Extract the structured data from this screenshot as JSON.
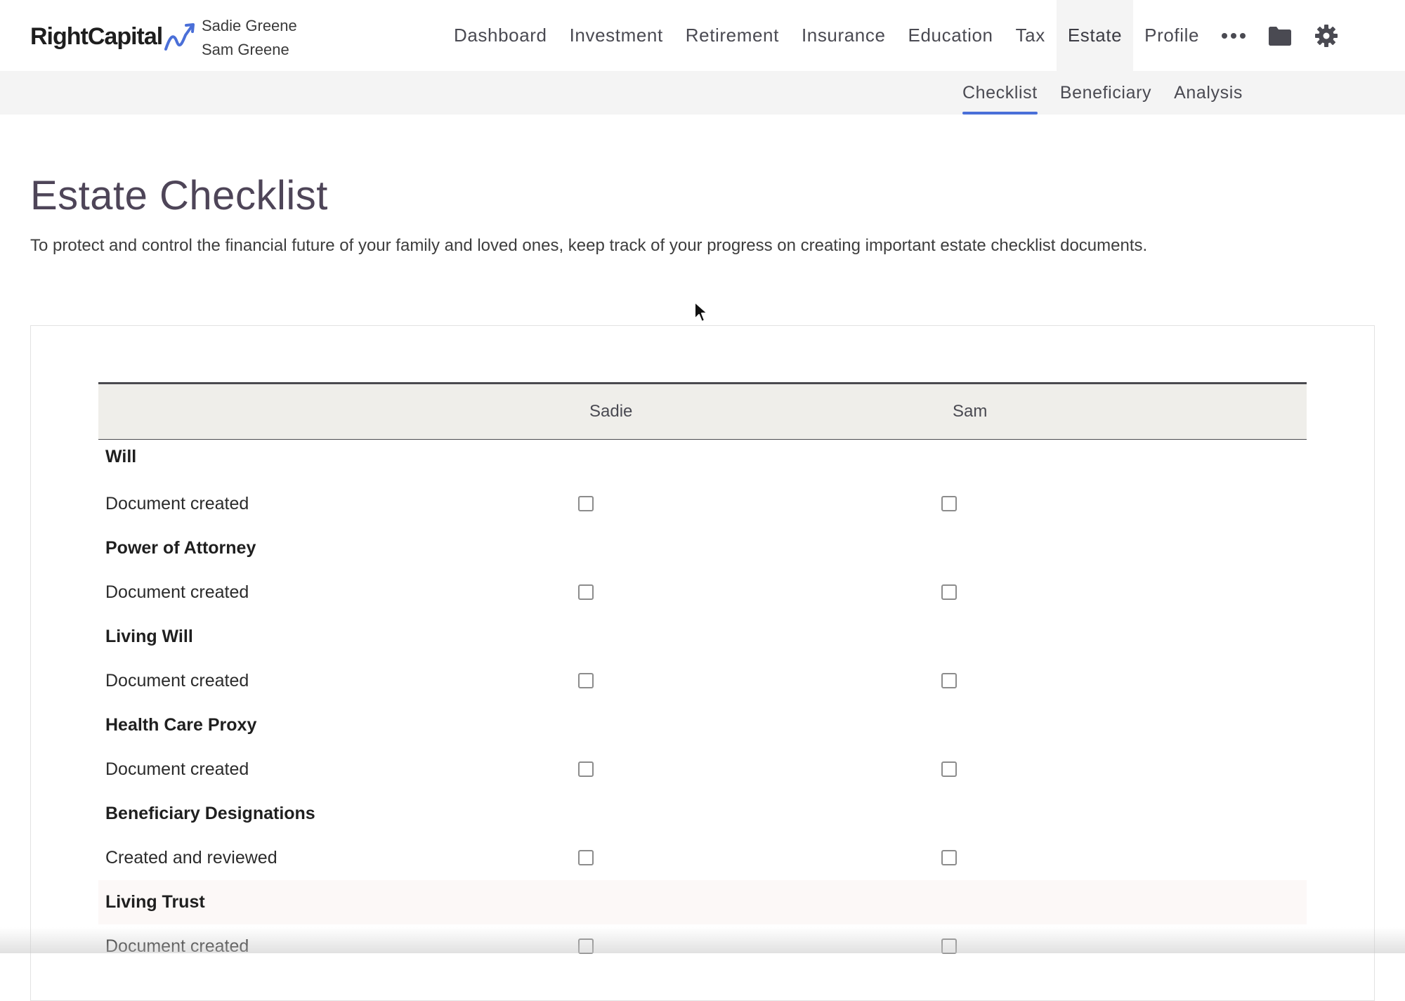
{
  "brand": {
    "name": "RightCapital",
    "accent_color": "#4a6fd8"
  },
  "clients": {
    "primary": "Sadie Greene",
    "spouse": "Sam Greene"
  },
  "main_nav": {
    "items": [
      {
        "label": "Dashboard"
      },
      {
        "label": "Investment"
      },
      {
        "label": "Retirement"
      },
      {
        "label": "Insurance"
      },
      {
        "label": "Education"
      },
      {
        "label": "Tax"
      },
      {
        "label": "Estate",
        "active": true
      },
      {
        "label": "Profile"
      }
    ],
    "icons": [
      "more-icon",
      "folder-icon",
      "gear-icon"
    ]
  },
  "sub_nav": {
    "items": [
      {
        "label": "Checklist",
        "active": true
      },
      {
        "label": "Beneficiary"
      },
      {
        "label": "Analysis"
      }
    ]
  },
  "page": {
    "title": "Estate Checklist",
    "description": "To protect and control the financial future of your family and loved ones, keep track of your progress on creating important estate checklist documents."
  },
  "table": {
    "columns": [
      "Sadie",
      "Sam"
    ],
    "sections": [
      {
        "title": "Will",
        "item": "Document created",
        "sadie_checked": false,
        "sam_checked": false
      },
      {
        "title": "Power of Attorney",
        "item": "Document created",
        "sadie_checked": false,
        "sam_checked": false
      },
      {
        "title": "Living Will",
        "item": "Document created",
        "sadie_checked": false,
        "sam_checked": false
      },
      {
        "title": "Health Care Proxy",
        "item": "Document created",
        "sadie_checked": false,
        "sam_checked": false
      },
      {
        "title": "Beneficiary Designations",
        "item": "Created and reviewed",
        "sadie_checked": false,
        "sam_checked": false
      },
      {
        "title": "Living Trust",
        "item": "Document created",
        "sadie_checked": false,
        "sam_checked": false
      }
    ]
  }
}
